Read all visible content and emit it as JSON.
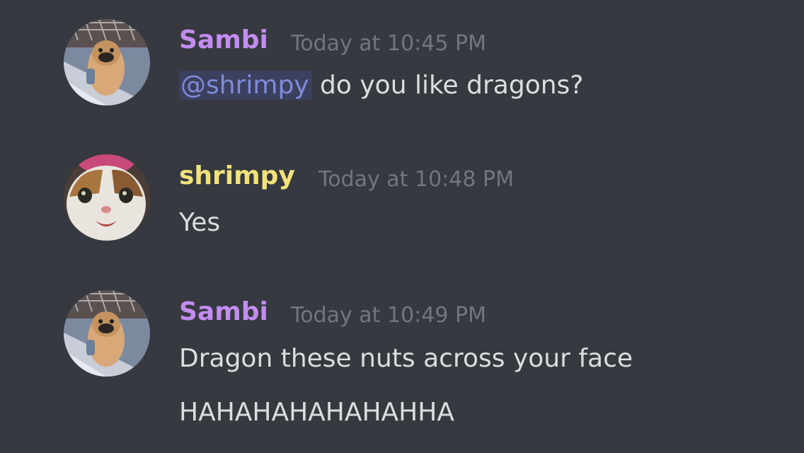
{
  "colors": {
    "background": "#36393f",
    "sambi_name": "#c38cf0",
    "shrimpy_name": "#f2e27a",
    "timestamp": "#72767d",
    "text": "#dcddde",
    "mention": "#7f8bd9"
  },
  "messages": [
    {
      "author": "Sambi",
      "timestamp": "Today at 10:45 PM",
      "mention": "@shrimpy",
      "lines": [
        " do you like dragons?"
      ],
      "avatar_icon": "pug-avatar-icon"
    },
    {
      "author": "shrimpy",
      "timestamp": "Today at 10:48 PM",
      "lines": [
        "Yes"
      ],
      "avatar_icon": "cat-avatar-icon"
    },
    {
      "author": "Sambi",
      "timestamp": "Today at 10:49 PM",
      "lines": [
        "Dragon these nuts across your face",
        "HAHAHAHAHAHAHHA"
      ],
      "avatar_icon": "pug-avatar-icon"
    }
  ]
}
